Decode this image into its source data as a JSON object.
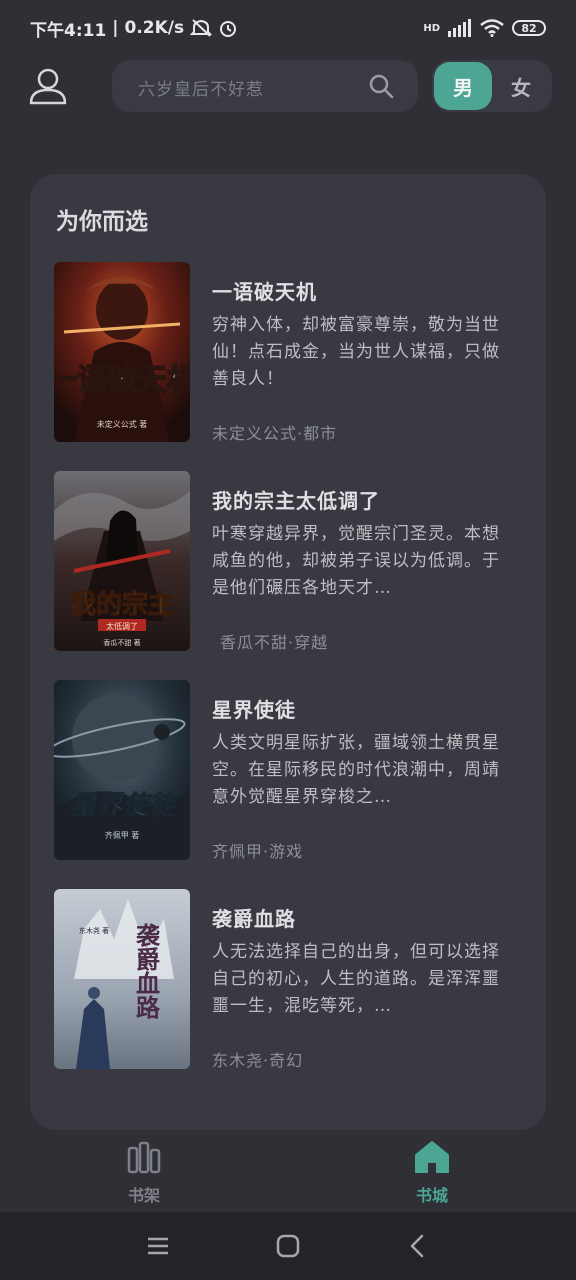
{
  "status": {
    "time": "下午4:11",
    "speed": "0.2K/s",
    "network": "HD",
    "battery": "82"
  },
  "header": {
    "search_placeholder": "六岁皇后不好惹",
    "gender_male": "男",
    "gender_female": "女"
  },
  "section": {
    "title": "为你而选"
  },
  "books": [
    {
      "title": "一语破天机",
      "desc": "穷神入体，却被富豪尊崇，敬为当世仙！点石成金，当为世人谋福，只做善良人！",
      "meta": "未定义公式·都市",
      "cover_text": "一语破天机",
      "cover_author": "未定义公式 著"
    },
    {
      "title": "我的宗主太低调了",
      "desc": "叶寒穿越异界，觉醒宗门圣灵。本想咸鱼的他，却被弟子误以为低调。于是他们碾压各地天才…",
      "meta": "香瓜不甜·穿越",
      "cover_text": "我的宗主",
      "cover_sub": "太低调了",
      "cover_author": "香瓜不甜 著"
    },
    {
      "title": "星界使徒",
      "desc": "人类文明星际扩张，疆域领土横贯星空。在星际移民的时代浪潮中，周靖意外觉醒星界穿梭之…",
      "meta": "齐佩甲·游戏",
      "cover_text": "星界使徒",
      "cover_author": "齐佩甲 著"
    },
    {
      "title": "袭爵血路",
      "desc": "人无法选择自己的出身，但可以选择自己的初心，人生的道路。是浑浑噩噩一生，混吃等死，…",
      "meta": "东木尧·奇幻",
      "cover_text": "袭爵血路",
      "cover_author": "东木尧 著"
    }
  ],
  "nav": {
    "bookshelf": "书架",
    "bookstore": "书城"
  },
  "colors": {
    "accent": "#4da593",
    "background": "#2f3036",
    "card": "#393a41"
  }
}
